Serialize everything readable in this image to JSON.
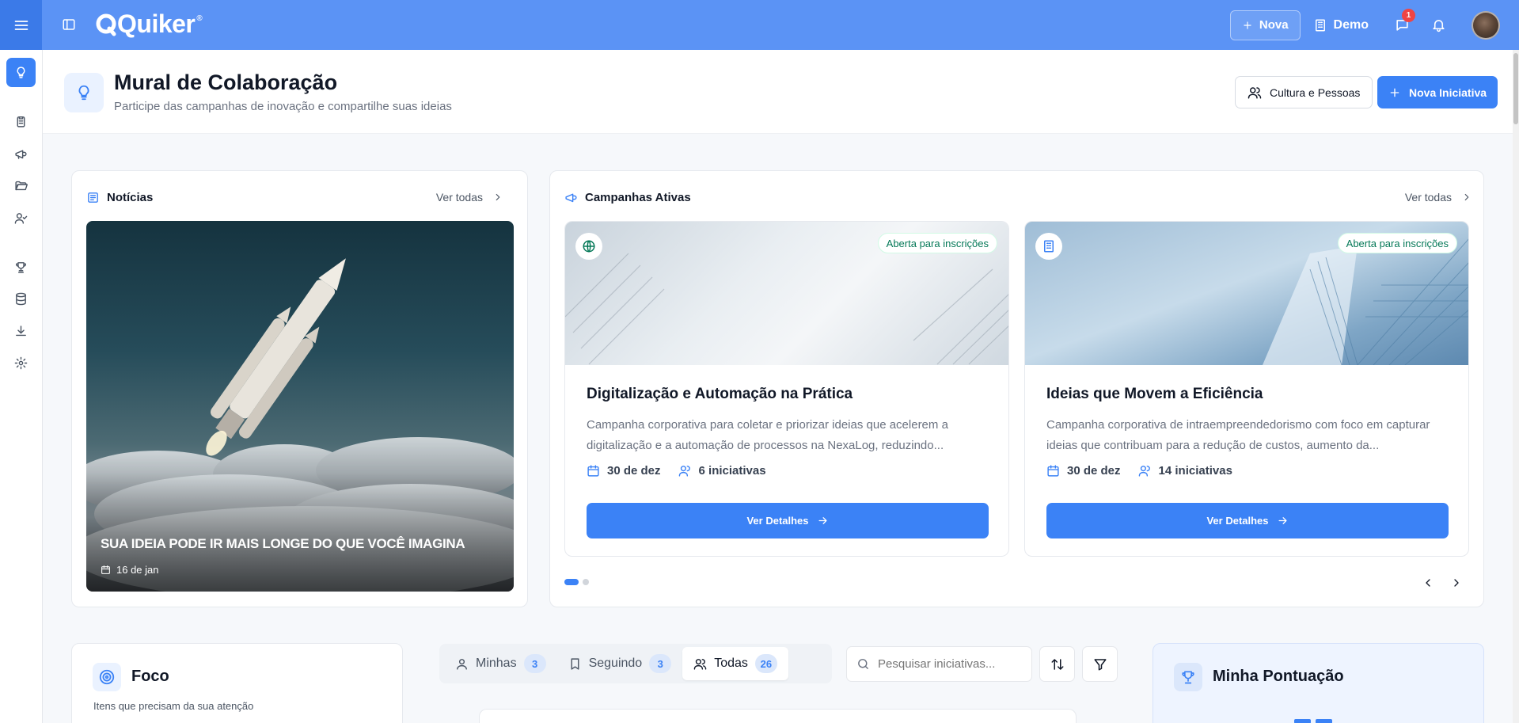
{
  "topbar": {
    "brand": "Quiker",
    "brand_mark": "®",
    "nova_label": "Nova",
    "org_label": "Demo",
    "messages_count": "1"
  },
  "header": {
    "title": "Mural de Colaboração",
    "subtitle": "Participe das campanhas de inovação e compartilhe suas ideias",
    "culture_button": "Cultura e Pessoas",
    "new_initiative_button": "Nova Iniciativa"
  },
  "news": {
    "title": "Notícias",
    "see_all": "Ver todas",
    "item": {
      "headline": "SUA IDEIA PODE IR MAIS LONGE DO QUE VOCÊ IMAGINA",
      "date": "16 de jan"
    }
  },
  "campaigns": {
    "title": "Campanhas Ativas",
    "see_all": "Ver todas",
    "items": [
      {
        "status": "Aberta para inscrições",
        "icon": "globe-icon",
        "title": "Digitalização e Automação na Prática",
        "description": "Campanha corporativa para coletar e priorizar ideias que acelerem a digitalização e a automação de processos na NexaLog, reduzindo...",
        "date": "30 de dez",
        "initiatives": "6 iniciativas",
        "button": "Ver Detalhes"
      },
      {
        "status": "Aberta para inscrições",
        "icon": "building-icon",
        "title": "Ideias que Movem a Eficiência",
        "description": "Campanha corporativa de intraempreendedorismo com foco em capturar ideias que contribuam para a redução de custos, aumento da...",
        "date": "30 de dez",
        "initiatives": "14 iniciativas",
        "button": "Ver Detalhes"
      }
    ]
  },
  "focus": {
    "title": "Foco",
    "subtitle": "Itens que precisam da sua atenção"
  },
  "tabs": [
    {
      "label": "Minhas",
      "count": "3"
    },
    {
      "label": "Seguindo",
      "count": "3"
    },
    {
      "label": "Todas",
      "count": "26"
    }
  ],
  "search": {
    "placeholder": "Pesquisar iniciativas..."
  },
  "score": {
    "title": "Minha Pontuação"
  },
  "colors": {
    "primary": "#3b82f6",
    "topbar": "#5b93f5",
    "success": "#047857"
  }
}
